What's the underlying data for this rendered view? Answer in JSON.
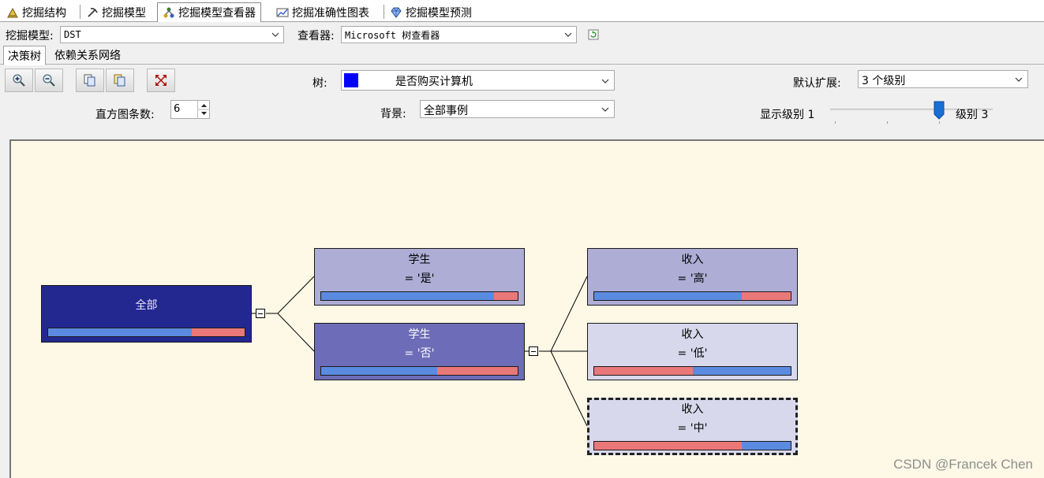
{
  "designer_tabs": [
    "挖掘结构",
    "挖掘模型",
    "挖掘模型查看器",
    "挖掘准确性图表",
    "挖掘模型预测"
  ],
  "model_row": {
    "model_label": "挖掘模型:",
    "model_value": "DST",
    "viewer_label": "查看器:",
    "viewer_value": "Microsoft 树查看器"
  },
  "viewer_tabs": [
    "决策树",
    "依赖关系网络"
  ],
  "toolbar": {
    "tree_label": "树:",
    "tree_value": "是否购买计算机",
    "tree_color": "#0000ff",
    "default_expand_label": "默认扩展:",
    "default_expand_value": "3 个级别",
    "histogram_label": "直方图条数:",
    "histogram_value": "6",
    "background_label": "背景:",
    "background_value": "全部事例",
    "show_level_label": "显示级别 1",
    "level_end_label": "级别 3",
    "show_level_value": 3
  },
  "tree": {
    "root": {
      "title": "全部",
      "bar": [
        0.73,
        0.27
      ],
      "bg": "#232891",
      "fg": "#e8e8f4"
    },
    "level2": [
      {
        "title": "学生",
        "cond": "= '是'",
        "bar": [
          0.88,
          0.12
        ],
        "bg": "#adadd6",
        "fg": "#000000"
      },
      {
        "title": "学生",
        "cond": "= '否'",
        "bar": [
          0.59,
          0.41
        ],
        "bg": "#6c6cb8",
        "fg": "#ffffff"
      }
    ],
    "level3": [
      {
        "title": "收入",
        "cond": "= '高'",
        "bar": [
          0.75,
          0.25
        ],
        "first": "blue",
        "bg": "#adadd6"
      },
      {
        "title": "收入",
        "cond": "= '低'",
        "bar": [
          0.5,
          0.5
        ],
        "first": "red",
        "bg": "#d8d8ec"
      },
      {
        "title": "收入",
        "cond": "= '中'",
        "bar": [
          0.75,
          0.25
        ],
        "first": "red",
        "bg": "#d8d8ec"
      }
    ]
  },
  "colors": {
    "canvas": "#fdf9e6",
    "bar_blue": "#5b8be0",
    "bar_red": "#eb7878"
  },
  "watermark": "CSDN @Francek Chen"
}
